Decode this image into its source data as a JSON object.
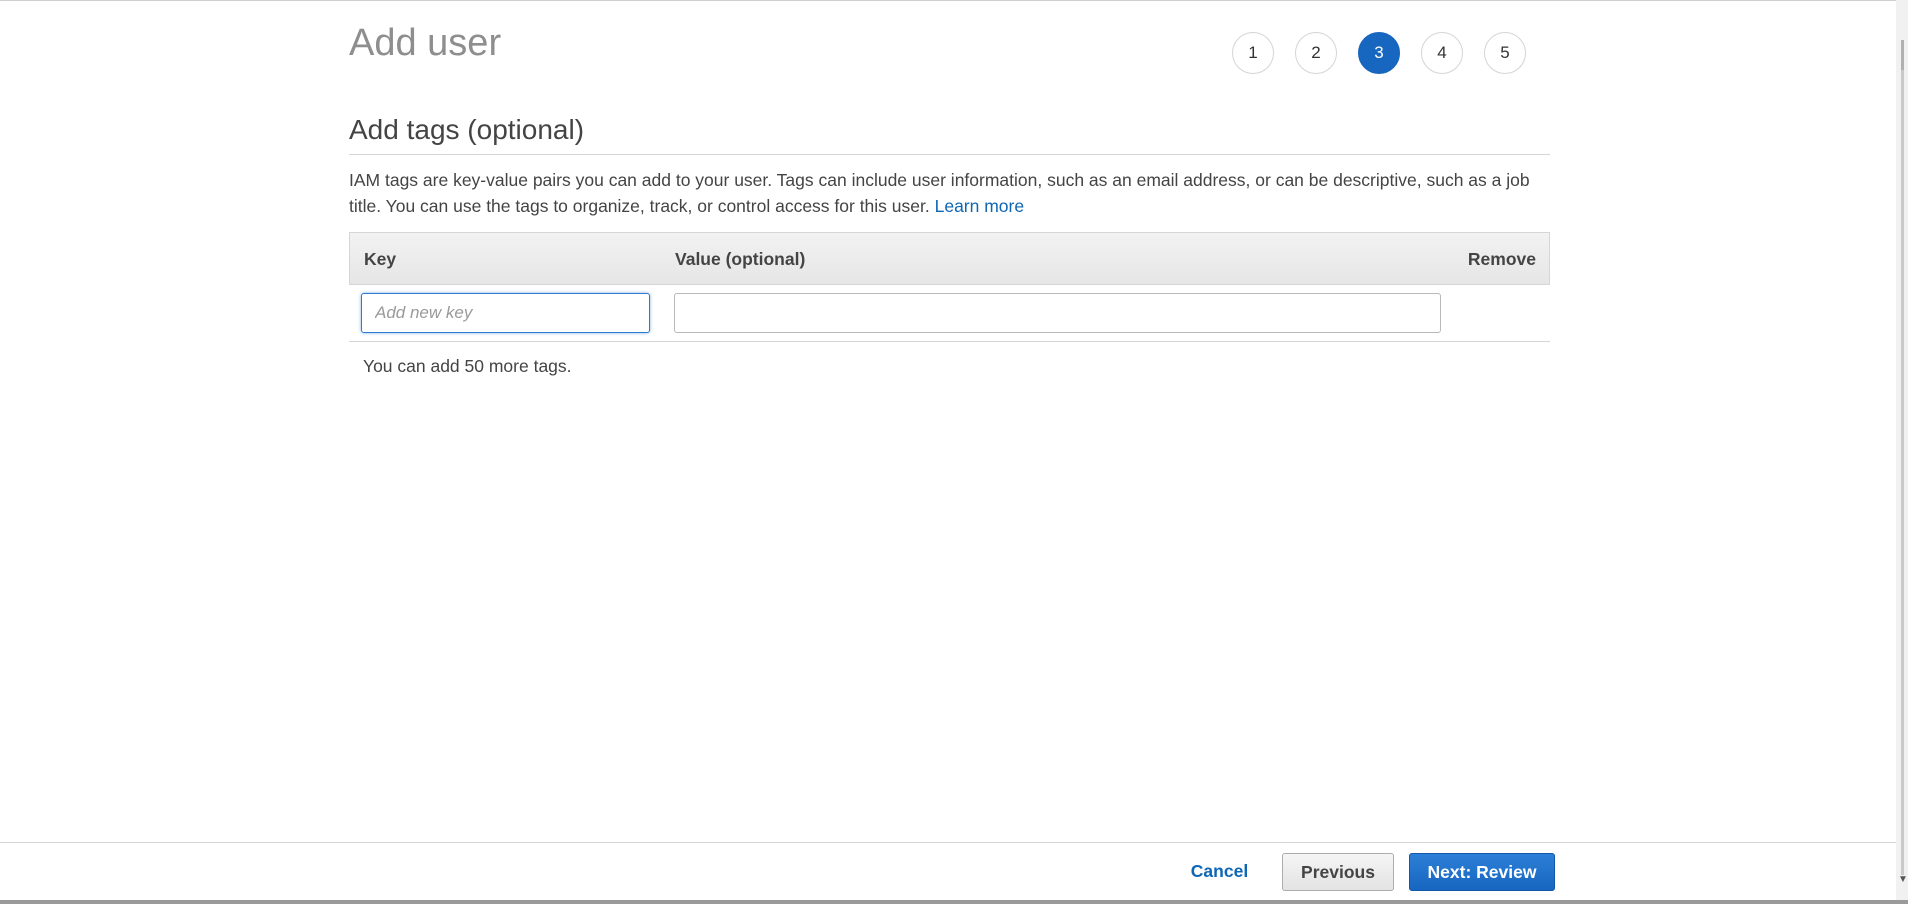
{
  "page": {
    "title": "Add user"
  },
  "wizard": {
    "steps": [
      "1",
      "2",
      "3",
      "4",
      "5"
    ],
    "active_step": "3"
  },
  "section": {
    "title": "Add tags (optional)",
    "description": "IAM tags are key-value pairs you can add to your user. Tags can include user information, such as an email address, or can be descriptive, such as a job title. You can use the tags to organize, track, or control access for this user.",
    "learn_more": "Learn more"
  },
  "tags_table": {
    "headers": {
      "key": "Key",
      "value": "Value (optional)",
      "remove": "Remove"
    },
    "rows": [
      {
        "key_value": "",
        "key_placeholder": "Add new key",
        "value_value": "",
        "value_placeholder": ""
      }
    ],
    "remaining_text": "You can add 50 more tags."
  },
  "footer": {
    "cancel_label": "Cancel",
    "previous_label": "Previous",
    "next_label": "Next: Review"
  },
  "colors": {
    "accent": "#1766c0",
    "link": "#0e66b4"
  }
}
